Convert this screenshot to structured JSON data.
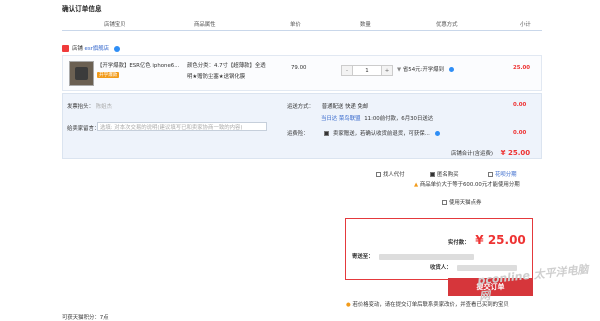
{
  "page": {
    "title": "确认订单信息"
  },
  "columns": [
    "店铺宝贝",
    "商品属性",
    "单价",
    "数量",
    "优惠方式",
    "小计"
  ],
  "shop": {
    "label": "店铺",
    "name": "esr旗舰店"
  },
  "item": {
    "name": "【开学爆款】ESR亿色 iphone6...",
    "badge": "开学爆款",
    "attrs_line1": "颜色分类：4.7寸【超薄款】全透",
    "attrs_line2": "明★赠防尘塞★送钢化膜",
    "price": "79.00",
    "qty": "1",
    "minus": "-",
    "plus": "+",
    "promo": "省54元:开学爆到",
    "subtotal": "25.00"
  },
  "invoice": {
    "label": "发票抬头：",
    "name_blurred": "陈姐杰",
    "value": "0.00"
  },
  "shipping": {
    "label": "运送方式：",
    "method": "普通配送 快递 免邮",
    "badge": "当日达",
    "extra": "菜鸟联盟",
    "eta": "11:00前付款，6月30日送达",
    "value": "0.00"
  },
  "message": {
    "label": "给卖家留言：",
    "placeholder": "选填: 对本次交易的说明(建议填写已和卖家协商一致的内容)"
  },
  "insurance": {
    "label": "运费险：",
    "text": "卖家赠送，若确认收货前退货，可获保...",
    "value": "0.00"
  },
  "shop_total": {
    "label": "店铺合计(含运费)",
    "value": "¥ 25.00"
  },
  "options": {
    "friend_pay": "找人代付",
    "anon_buy": "匿名购买",
    "credit": "花呗分期",
    "installment_note": "商品单价大于等于600.00元才能使用分期",
    "tmall_points": "使用天猫点券"
  },
  "summary": {
    "paid_label": "实付款：",
    "paid_value": "¥ 25.00",
    "ship_to_label": "寄送至：",
    "receiver_label": "收货人："
  },
  "submit_label": "提交订单",
  "footer_note": "若价格变动，请在提交订单后联系卖家改价，并查看已买到的宝贝",
  "footer_left": "可获天猫积分：7点",
  "watermark": "pconline 太平洋电脑网"
}
